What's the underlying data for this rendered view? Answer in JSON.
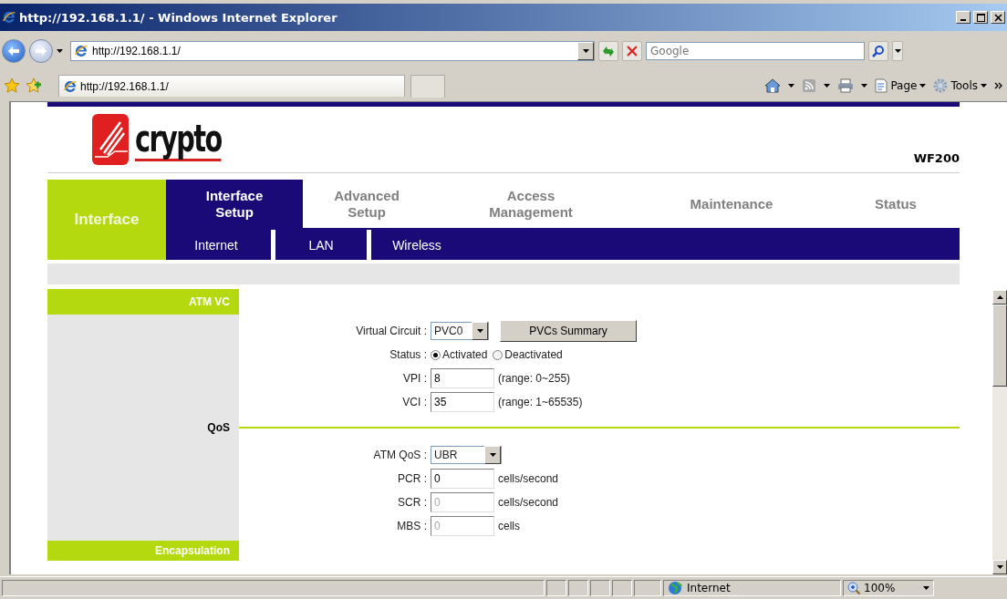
{
  "window": {
    "title": "http://192.168.1.1/ - Windows Internet Explorer"
  },
  "address_bar": {
    "value": "http://192.168.1.1/"
  },
  "search": {
    "placeholder": "Google"
  },
  "favorites_bar": {
    "tab": "http://192.168.1.1/",
    "commands": [
      "Page",
      "Tools"
    ]
  },
  "page": {
    "brand": "crypto",
    "model": "WF200",
    "section": "Interface",
    "nav": [
      {
        "label": "Interface Setup",
        "selected": true
      },
      {
        "label": "Advanced Setup",
        "selected": false
      },
      {
        "label": "Access Management",
        "selected": false
      },
      {
        "label": "Maintenance",
        "selected": false
      },
      {
        "label": "Status",
        "selected": false
      }
    ],
    "subnav": [
      {
        "label": "Internet"
      },
      {
        "label": "LAN"
      },
      {
        "label": "Wireless"
      }
    ],
    "sections": [
      {
        "kind": "header",
        "title": "ATM VC",
        "rows": [
          {
            "kind": "select",
            "label": "Virtual Circuit :",
            "value": "PVC0",
            "button": "PVCs Summary"
          },
          {
            "kind": "radio",
            "label": "Status :",
            "options": [
              {
                "label": "Activated",
                "selected": true
              },
              {
                "label": "Deactivated",
                "selected": false
              }
            ]
          },
          {
            "kind": "input",
            "label": "VPI :",
            "value": "8",
            "hint": "(range: 0~255)",
            "disabled": false
          },
          {
            "kind": "input",
            "label": "VCI :",
            "value": "35",
            "hint": "(range: 1~65535)",
            "disabled": false
          }
        ]
      },
      {
        "kind": "divider",
        "title": "QoS",
        "rows": [
          {
            "kind": "select",
            "label": "ATM QoS :",
            "value": "UBR"
          },
          {
            "kind": "input",
            "label": "PCR :",
            "value": "0",
            "hint": "cells/second",
            "disabled": false
          },
          {
            "kind": "input",
            "label": "SCR :",
            "value": "0",
            "hint": "cells/second",
            "disabled": true
          },
          {
            "kind": "input",
            "label": "MBS :",
            "value": "0",
            "hint": "cells",
            "disabled": true
          }
        ]
      },
      {
        "kind": "header",
        "title": "Encapsulation"
      }
    ]
  },
  "status_bar": {
    "zone": "Internet",
    "zoom": "100%"
  }
}
